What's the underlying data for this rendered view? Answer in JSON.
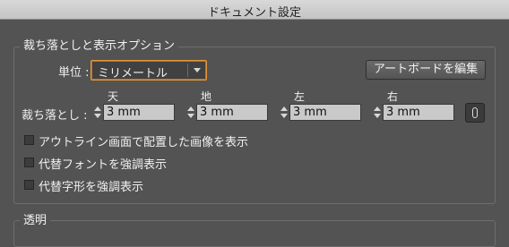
{
  "window": {
    "title": "ドキュメント設定"
  },
  "bleed_section": {
    "label": "裁ち落としと表示オプション",
    "unit": {
      "label": "単位 :",
      "value": "ミリメートル"
    },
    "artboard_button": "アートボードを編集",
    "bleed_label": "裁ち落とし :",
    "fields": [
      {
        "label": "天",
        "value": "3 mm"
      },
      {
        "label": "地",
        "value": "3 mm"
      },
      {
        "label": "左",
        "value": "3 mm"
      },
      {
        "label": "右",
        "value": "3 mm"
      }
    ],
    "checkboxes": [
      {
        "label": "アウトライン画面で配置した画像を表示",
        "checked": false
      },
      {
        "label": "代替フォントを強調表示",
        "checked": false
      },
      {
        "label": "代替字形を強調表示",
        "checked": false
      }
    ]
  },
  "transparency_section": {
    "label": "透明"
  },
  "icons": {
    "link": "link-chain-icon",
    "dropdown": "chevron-down-icon",
    "stepper": "stepper-arrows-icon"
  }
}
